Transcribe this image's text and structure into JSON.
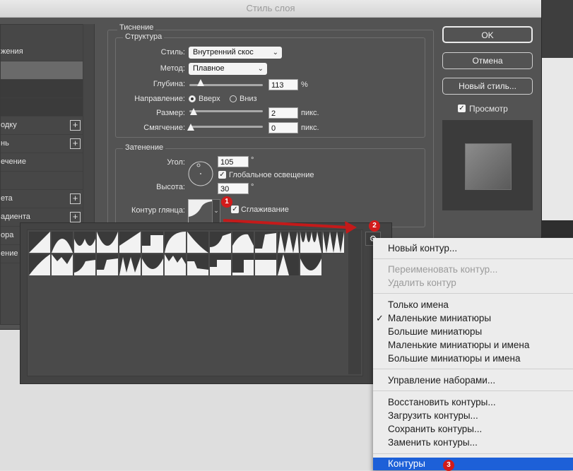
{
  "window": {
    "title": "Стиль слоя"
  },
  "left_list": {
    "items": [
      {
        "label": "жения",
        "plus": false
      },
      {
        "label": "",
        "plus": false
      },
      {
        "label": "",
        "plus": false
      },
      {
        "label": "",
        "plus": false
      },
      {
        "label": "одку",
        "plus": true
      },
      {
        "label": "нь",
        "plus": true
      },
      {
        "label": "ечение",
        "plus": false
      },
      {
        "label": "",
        "plus": false
      },
      {
        "label": "ета",
        "plus": true
      },
      {
        "label": "адиента",
        "plus": true
      },
      {
        "label": "ора",
        "plus": true
      },
      {
        "label": "ение",
        "plus": false
      }
    ]
  },
  "emboss": {
    "section_title": "Тиснение",
    "structure": {
      "title": "Структура",
      "style_label": "Стиль:",
      "style_value": "Внутренний скос",
      "method_label": "Метод:",
      "method_value": "Плавное",
      "depth_label": "Глубина:",
      "depth_value": "113",
      "depth_unit": "%",
      "direction_label": "Направление:",
      "direction_up": "Вверх",
      "direction_down": "Вниз",
      "size_label": "Размер:",
      "size_value": "2",
      "size_unit": "пикс.",
      "soften_label": "Смягчение:",
      "soften_value": "0",
      "soften_unit": "пикс."
    },
    "shading": {
      "title": "Затенение",
      "angle_label": "Угол:",
      "angle_value": "105",
      "angle_unit": "°",
      "global_light_label": "Глобальное освещение",
      "altitude_label": "Высота:",
      "altitude_value": "30",
      "altitude_unit": "°",
      "gloss_label": "Контур глянца:",
      "antialias_label": "Сглаживание"
    }
  },
  "buttons": {
    "ok": "OK",
    "cancel": "Отмена",
    "new_style": "Новый стиль...",
    "preview_label": "Просмотр"
  },
  "badges": {
    "one": "1",
    "two": "2",
    "three": "3"
  },
  "menu": {
    "new_contour": "Новый контур...",
    "rename_contour": "Переименовать контур...",
    "delete_contour": "Удалить контур",
    "names_only": "Только имена",
    "small_thumbs": "Маленькие миниатюры",
    "large_thumbs": "Большие миниатюры",
    "small_list": "Маленькие миниатюры и имена",
    "large_list": "Большие миниатюры и имена",
    "manage_presets": "Управление наборами...",
    "reset": "Восстановить контуры...",
    "load": "Загрузить контуры...",
    "save": "Сохранить контуры...",
    "replace": "Заменить контуры...",
    "contours": "Контуры",
    "checkmark": "✓"
  },
  "colors": {
    "accent_red": "#d21b1b",
    "menu_highlight": "#1d60d8"
  }
}
